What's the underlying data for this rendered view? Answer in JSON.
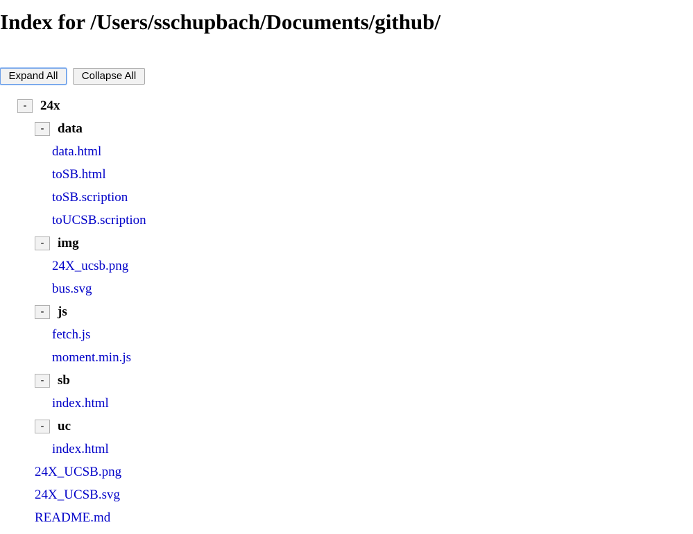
{
  "page": {
    "title": "Index for /Users/sschupbach/Documents/github/"
  },
  "controls": {
    "expand_all": "Expand All",
    "collapse_all": "Collapse All"
  },
  "colors": {
    "link": "#0000c8",
    "focus": "#6b9ee8"
  },
  "tree": {
    "toggle_symbol": "-",
    "root": {
      "name": "24x",
      "folders": [
        {
          "name": "data",
          "files": [
            "data.html",
            "toSB.html",
            "toSB.scription",
            "toUCSB.scription"
          ]
        },
        {
          "name": "img",
          "files": [
            "24X_ucsb.png",
            "bus.svg"
          ]
        },
        {
          "name": "js",
          "files": [
            "fetch.js",
            "moment.min.js"
          ]
        },
        {
          "name": "sb",
          "files": [
            "index.html"
          ]
        },
        {
          "name": "uc",
          "files": [
            "index.html"
          ]
        }
      ],
      "files": [
        "24X_UCSB.png",
        "24X_UCSB.svg",
        "README.md"
      ]
    }
  }
}
